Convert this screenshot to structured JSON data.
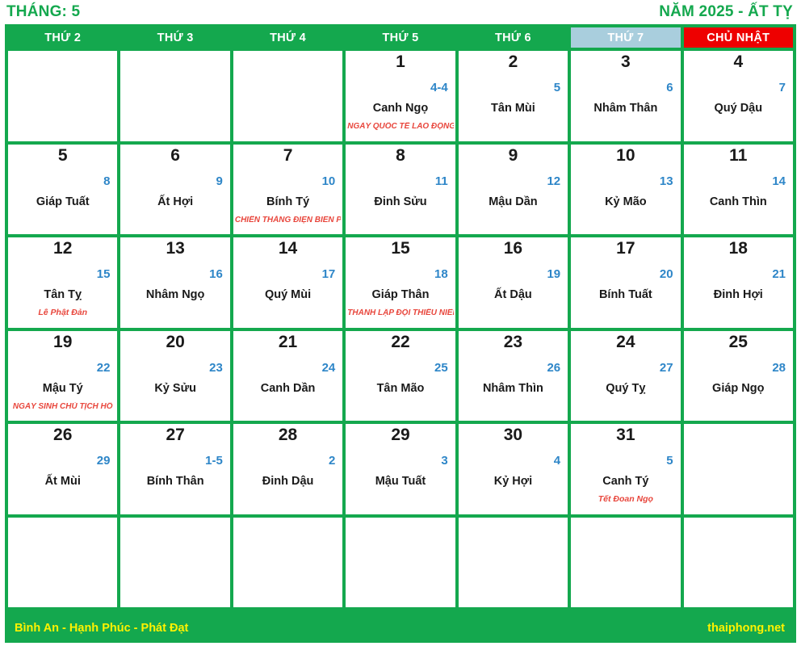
{
  "header": {
    "month_label": "THÁNG: 5",
    "year_label": "NĂM 2025 - ẤT TỴ"
  },
  "weekdays": [
    {
      "label": "THỨ 2",
      "kind": "weekday"
    },
    {
      "label": "THỨ 3",
      "kind": "weekday"
    },
    {
      "label": "THỨ 4",
      "kind": "weekday"
    },
    {
      "label": "THỨ 5",
      "kind": "weekday"
    },
    {
      "label": "THỨ 6",
      "kind": "weekday"
    },
    {
      "label": "THỨ 7",
      "kind": "saturday"
    },
    {
      "label": "CHỦ NHẬT",
      "kind": "sunday"
    }
  ],
  "colors": {
    "green": "#14A84E",
    "saturday_bg": "#A9CEDD",
    "sunday_bg": "#EE0000",
    "lunar_blue": "#2E86C8",
    "holiday_red": "#E8463C",
    "footer_yellow": "#FFF200"
  },
  "cells": [
    {
      "solar": "",
      "lunar": "",
      "canchi": "",
      "holiday": ""
    },
    {
      "solar": "",
      "lunar": "",
      "canchi": "",
      "holiday": ""
    },
    {
      "solar": "",
      "lunar": "",
      "canchi": "",
      "holiday": ""
    },
    {
      "solar": "1",
      "lunar": "4-4",
      "canchi": "Canh Ngọ",
      "holiday": "NGÀY QUỐC TẾ LAO ĐỘNG"
    },
    {
      "solar": "2",
      "lunar": "5",
      "canchi": "Tân Mùi",
      "holiday": ""
    },
    {
      "solar": "3",
      "lunar": "6",
      "canchi": "Nhâm Thân",
      "holiday": ""
    },
    {
      "solar": "4",
      "lunar": "7",
      "canchi": "Quý Dậu",
      "holiday": ""
    },
    {
      "solar": "5",
      "lunar": "8",
      "canchi": "Giáp Tuất",
      "holiday": ""
    },
    {
      "solar": "6",
      "lunar": "9",
      "canchi": "Ất Hợi",
      "holiday": ""
    },
    {
      "solar": "7",
      "lunar": "10",
      "canchi": "Bính Tý",
      "holiday": "CHIẾN THẮNG ĐIỆN BIÊN PHỦ"
    },
    {
      "solar": "8",
      "lunar": "11",
      "canchi": "Đinh Sửu",
      "holiday": ""
    },
    {
      "solar": "9",
      "lunar": "12",
      "canchi": "Mậu Dần",
      "holiday": ""
    },
    {
      "solar": "10",
      "lunar": "13",
      "canchi": "Kỷ Mão",
      "holiday": ""
    },
    {
      "solar": "11",
      "lunar": "14",
      "canchi": "Canh Thìn",
      "holiday": ""
    },
    {
      "solar": "12",
      "lunar": "15",
      "canchi": "Tân Tỵ",
      "holiday": "Lễ Phật Đản"
    },
    {
      "solar": "13",
      "lunar": "16",
      "canchi": "Nhâm Ngọ",
      "holiday": ""
    },
    {
      "solar": "14",
      "lunar": "17",
      "canchi": "Quý Mùi",
      "holiday": ""
    },
    {
      "solar": "15",
      "lunar": "18",
      "canchi": "Giáp Thân",
      "holiday": "THÀNH LẬP ĐỘI THIẾU NIÊN"
    },
    {
      "solar": "16",
      "lunar": "19",
      "canchi": "Ất Dậu",
      "holiday": ""
    },
    {
      "solar": "17",
      "lunar": "20",
      "canchi": "Bính Tuất",
      "holiday": ""
    },
    {
      "solar": "18",
      "lunar": "21",
      "canchi": "Đinh Hợi",
      "holiday": ""
    },
    {
      "solar": "19",
      "lunar": "22",
      "canchi": "Mậu Tý",
      "holiday": "NGÀY SINH CHỦ TỊCH HỒ"
    },
    {
      "solar": "20",
      "lunar": "23",
      "canchi": "Kỷ Sửu",
      "holiday": ""
    },
    {
      "solar": "21",
      "lunar": "24",
      "canchi": "Canh Dần",
      "holiday": ""
    },
    {
      "solar": "22",
      "lunar": "25",
      "canchi": "Tân Mão",
      "holiday": ""
    },
    {
      "solar": "23",
      "lunar": "26",
      "canchi": "Nhâm Thìn",
      "holiday": ""
    },
    {
      "solar": "24",
      "lunar": "27",
      "canchi": "Quý Tỵ",
      "holiday": ""
    },
    {
      "solar": "25",
      "lunar": "28",
      "canchi": "Giáp Ngọ",
      "holiday": ""
    },
    {
      "solar": "26",
      "lunar": "29",
      "canchi": "Ất Mùi",
      "holiday": ""
    },
    {
      "solar": "27",
      "lunar": "1-5",
      "canchi": "Bính Thân",
      "holiday": ""
    },
    {
      "solar": "28",
      "lunar": "2",
      "canchi": "Đinh Dậu",
      "holiday": ""
    },
    {
      "solar": "29",
      "lunar": "3",
      "canchi": "Mậu Tuất",
      "holiday": ""
    },
    {
      "solar": "30",
      "lunar": "4",
      "canchi": "Kỷ Hợi",
      "holiday": ""
    },
    {
      "solar": "31",
      "lunar": "5",
      "canchi": "Canh Tý",
      "holiday": "Tết Đoan Ngọ"
    },
    {
      "solar": "",
      "lunar": "",
      "canchi": "",
      "holiday": ""
    },
    {
      "solar": "",
      "lunar": "",
      "canchi": "",
      "holiday": ""
    },
    {
      "solar": "",
      "lunar": "",
      "canchi": "",
      "holiday": ""
    },
    {
      "solar": "",
      "lunar": "",
      "canchi": "",
      "holiday": ""
    },
    {
      "solar": "",
      "lunar": "",
      "canchi": "",
      "holiday": ""
    },
    {
      "solar": "",
      "lunar": "",
      "canchi": "",
      "holiday": ""
    },
    {
      "solar": "",
      "lunar": "",
      "canchi": "",
      "holiday": ""
    },
    {
      "solar": "",
      "lunar": "",
      "canchi": "",
      "holiday": ""
    }
  ],
  "footer": {
    "slogan": "Bình An - Hạnh Phúc - Phát Đạt",
    "website": "thaiphong.net"
  }
}
